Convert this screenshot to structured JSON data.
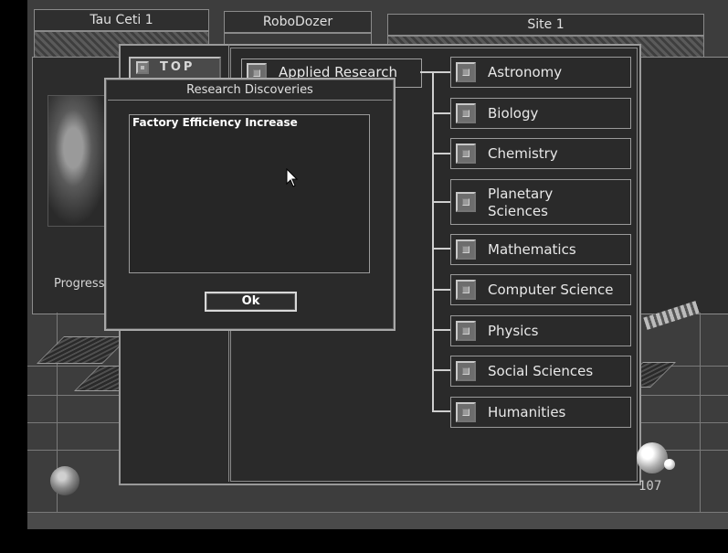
{
  "top_bar": {
    "location_tab": "Tau Ceti 1",
    "unit_tab": "RoboDozer",
    "site_tab": "Site 1"
  },
  "side_panel": {
    "progress_label": "Progress"
  },
  "research_tree": {
    "top_button": "TOP",
    "root_node": "Applied Research",
    "topics": [
      {
        "label": "Astronomy"
      },
      {
        "label": "Biology"
      },
      {
        "label": "Chemistry"
      },
      {
        "label_line1": "Planetary",
        "label_line2": "Sciences"
      },
      {
        "label": "Mathematics"
      },
      {
        "label": "Computer Science"
      },
      {
        "label": "Physics"
      },
      {
        "label": "Social Sciences"
      },
      {
        "label": "Humanities"
      }
    ]
  },
  "dialog": {
    "title": "Research Discoveries",
    "discovery_item": "Factory Efficiency Increase",
    "ok_label": "Ok"
  },
  "status": {
    "counter": "107"
  },
  "icons": {
    "globe": "globe-icon",
    "orb": "orb-icon",
    "cursor": "arrow-cursor-icon",
    "node_button": "square-button-icon"
  }
}
